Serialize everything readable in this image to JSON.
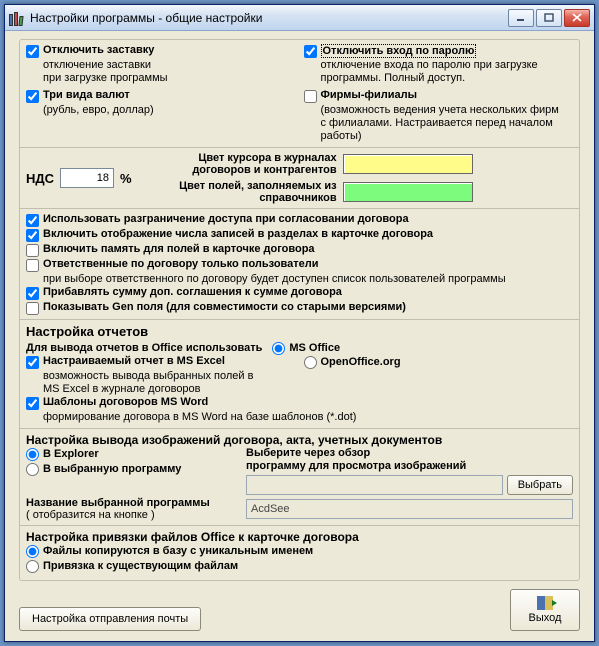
{
  "window": {
    "title": "Настройки программы - общие настройки"
  },
  "top": {
    "disable_splash": {
      "label": "Отключить заставку",
      "sub1": "отключение заставки",
      "sub2": "при загрузке программы"
    },
    "disable_pw_login": {
      "label": "Отключить вход по паролю",
      "sub1": "отключение входа по паролю при загрузке",
      "sub2": "программы. Полный доступ."
    },
    "three_currencies": {
      "label": "Три вида валют",
      "sub": "(рубль, евро, доллар)"
    },
    "branches": {
      "label": "Фирмы-филиалы",
      "sub1": "(возможность ведения учета нескольких фирм",
      "sub2": "с филиалами. Настраивается перед началом работы)"
    }
  },
  "nds": {
    "label": "НДС",
    "value": "18",
    "pct": "%"
  },
  "colors": {
    "cursor": "Цвет курсора в журналах договоров и контрагентов",
    "fields": "Цвет полей, заполняемых из справочников",
    "cursor_hex": "#fffc8a",
    "fields_hex": "#7dfb7d"
  },
  "flags": {
    "access_sep": "Использовать разграничение доступа при согласовании договора",
    "show_count": "Включить отображение числа записей в разделах в карточке договора",
    "field_memory": "Включить память для полей в карточке договора",
    "resp_users_only": "Ответственные по договору только пользователи",
    "resp_users_only_sub": "при выборе ответственного по договору будет доступен  список пользователей программы",
    "add_suppl_sum": "Прибавлять сумму доп. соглашения к сумме договора",
    "show_gen": "Показывать Gen поля (для совместимости со старыми версиями)"
  },
  "reports": {
    "title": "Настройка отчетов",
    "office_label": "Для вывода отчетов в Office использовать",
    "msoffice": "MS Office",
    "openoffice": "OpenOffice.org",
    "excel_custom": "Настраиваемый отчет в MS Excel",
    "excel_custom_sub1": "возможность вывода выбранных полей в",
    "excel_custom_sub2": "MS Excel в журнале договоров",
    "word_tpl": "Шаблоны договоров MS Word",
    "word_tpl_sub": "формирование договора в MS Word на базе шаблонов (*.dot)"
  },
  "images": {
    "title": "Настройка вывода изображений договора,  акта, учетных документов",
    "explorer": "В Explorer",
    "chosen_prog": "В выбранную программу",
    "browse_hint1": "Выберите через обзор",
    "browse_hint2": "программу для просмотра изображений",
    "browse_btn": "Выбрать",
    "prog_name_label": "Название выбранной программы",
    "prog_name_sub": "( отобразится на кнопке )",
    "prog_name_value": "AcdSee"
  },
  "binding": {
    "title": "Настройка привязки файлов Office к карточке договора",
    "copy": "Файлы копируются в базу с уникальным именем",
    "link": "Привязка к существующим файлам"
  },
  "footer": {
    "mail_btn": "Настройка отправления почты",
    "exit": "Выход"
  }
}
